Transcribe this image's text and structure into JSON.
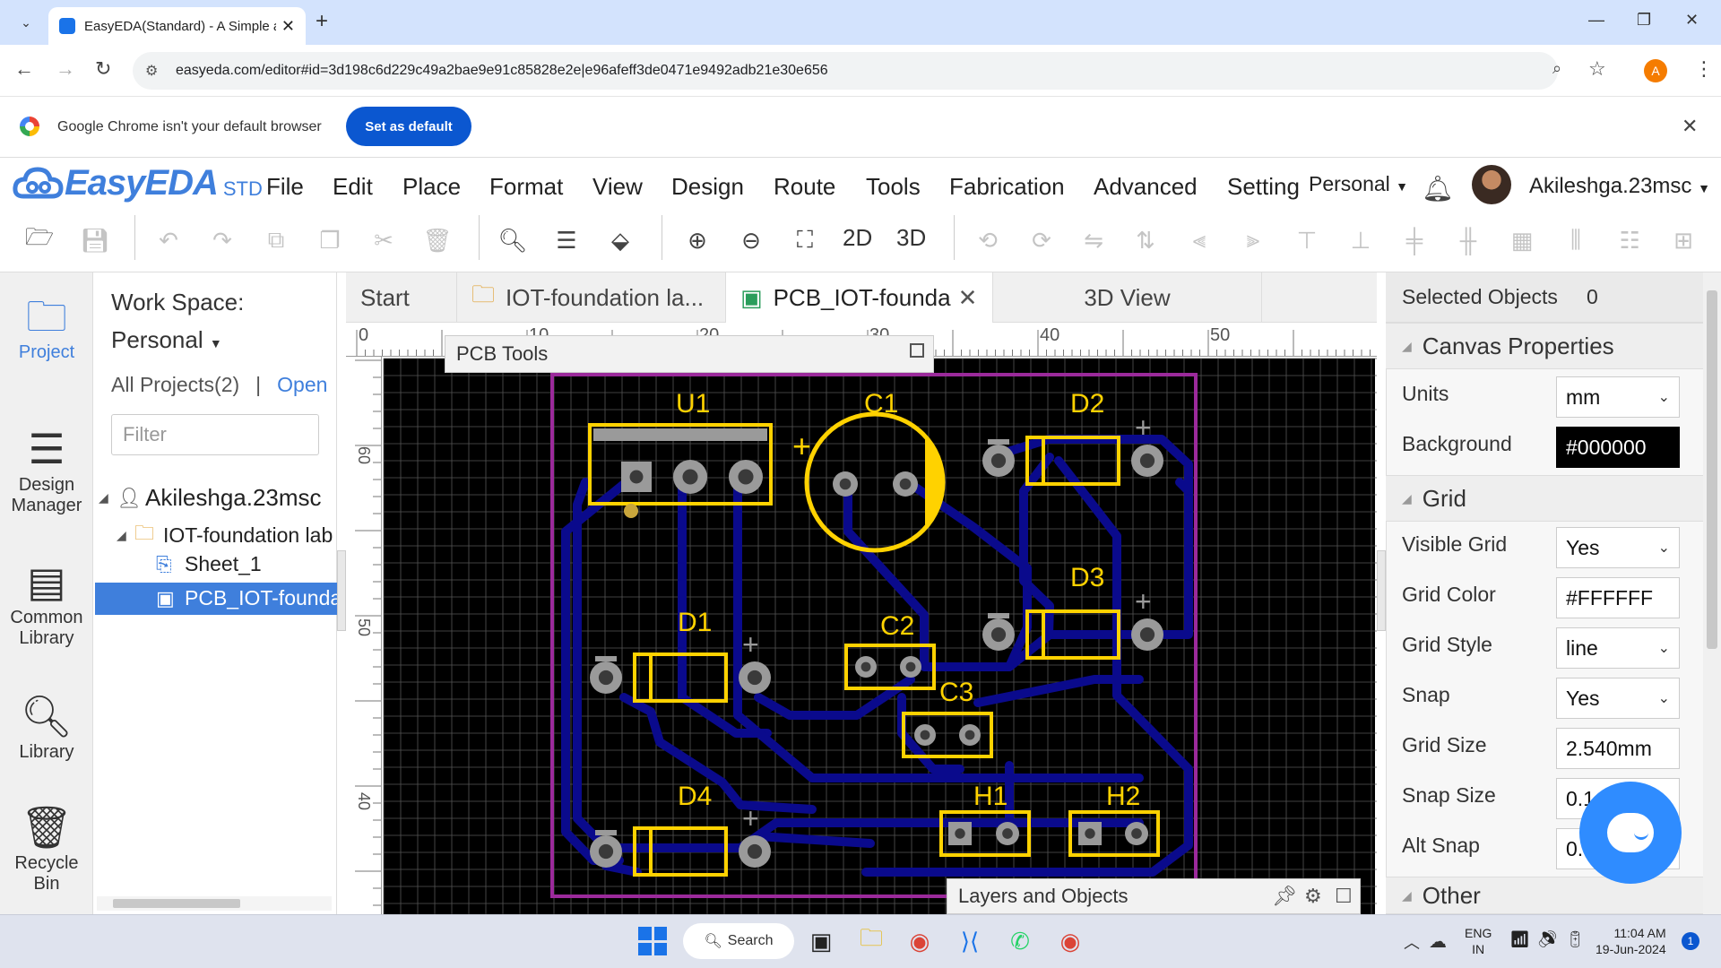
{
  "browser": {
    "tab_title": "EasyEDA(Standard) - A Simple a",
    "url": "easyeda.com/editor#id=3d198c6d229c49a2bae9e91c85828e2e|e96afeff3de0471e9492adb21e30e656",
    "profile_initial": "A",
    "infobar_message": "Google Chrome isn't your default browser",
    "set_default_label": "Set as default"
  },
  "app": {
    "brand": "EasyEDA",
    "edition": "STD",
    "menu": [
      "File",
      "Edit",
      "Place",
      "Format",
      "View",
      "Design",
      "Route",
      "Tools",
      "Fabrication",
      "Advanced",
      "Setting"
    ],
    "workspace_selector": "Personal",
    "username": "Akileshga.23msc",
    "toolbar_2d": "2D",
    "toolbar_3d": "3D"
  },
  "rail": {
    "project": "Project",
    "design_manager": "Design Manager",
    "common_library": "Common Library",
    "library": "Library",
    "recycle": "Recycle Bin"
  },
  "project_panel": {
    "workspace_label": "Work Space:",
    "workspace_value": "Personal",
    "all_projects": "All Projects(2)",
    "separator": "|",
    "open_label": "Open",
    "filter_placeholder": "Filter",
    "tree": {
      "user": "Akileshga.23msc",
      "folder": "IOT-foundation lab",
      "sheet": "Sheet_1",
      "pcb": "PCB_IOT-foundation"
    }
  },
  "doc_tabs": {
    "start": "Start",
    "iot": "IOT-foundation la...",
    "pcb": "PCB_IOT-founda",
    "view3d": "3D View"
  },
  "canvas": {
    "pcb_tools_title": "PCB Tools",
    "layers_title": "Layers and Objects",
    "ruler_top": [
      "0",
      "10",
      "20",
      "30",
      "40",
      "50"
    ],
    "ruler_left": [
      "60",
      "50",
      "40"
    ],
    "components": [
      "U1",
      "C1",
      "D2",
      "D3",
      "D1",
      "C2",
      "C3",
      "D4",
      "H1",
      "H2"
    ],
    "board_color": "#000000",
    "track_color": "#0a0a8c",
    "silk_color": "#ffd200",
    "outline_color": "#9b2a9b"
  },
  "properties": {
    "selected_label": "Selected Objects",
    "selected_count": "0",
    "canvas_section": "Canvas Properties",
    "units_label": "Units",
    "units_value": "mm",
    "background_label": "Background",
    "background_value": "#000000",
    "grid_section": "Grid",
    "visible_grid_label": "Visible Grid",
    "visible_grid_value": "Yes",
    "grid_color_label": "Grid Color",
    "grid_color_value": "#FFFFFF",
    "grid_style_label": "Grid Style",
    "grid_style_value": "line",
    "snap_label": "Snap",
    "snap_value": "Yes",
    "grid_size_label": "Grid Size",
    "grid_size_value": "2.540mm",
    "snap_size_label": "Snap Size",
    "snap_size_value": "0.1",
    "alt_snap_label": "Alt Snap",
    "alt_snap_value": "0.",
    "other_section": "Other"
  },
  "taskbar": {
    "search_label": "Search",
    "lang": "ENG",
    "region": "IN",
    "time": "11:04 AM",
    "date": "19-Jun-2024",
    "notifications": "1"
  }
}
